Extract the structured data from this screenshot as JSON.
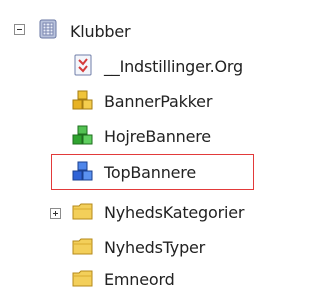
{
  "tree": {
    "root": {
      "label": "Klubber",
      "icon": "database-icon",
      "expanded": true
    },
    "items": [
      {
        "label": "__Indstillinger.Org",
        "icon": "settings-doc-icon"
      },
      {
        "label": "BannerPakker",
        "icon": "yellow-cubes-icon"
      },
      {
        "label": "HojreBannere",
        "icon": "green-cubes-icon"
      },
      {
        "label": "TopBannere",
        "icon": "blue-cubes-icon",
        "selected": true
      },
      {
        "label": "NyhedsKategorier",
        "icon": "folder-icon",
        "collapsed": true
      },
      {
        "label": "NyhedsTyper",
        "icon": "folder-icon"
      },
      {
        "label": "Emneord",
        "icon": "folder-icon"
      }
    ]
  },
  "colors": {
    "selection_border": "#e23a3a",
    "folder": "#f3cf5a",
    "yellow_cubes": "#e7b224",
    "green_cubes": "#2fa32f",
    "blue_cubes": "#2f63d6"
  }
}
